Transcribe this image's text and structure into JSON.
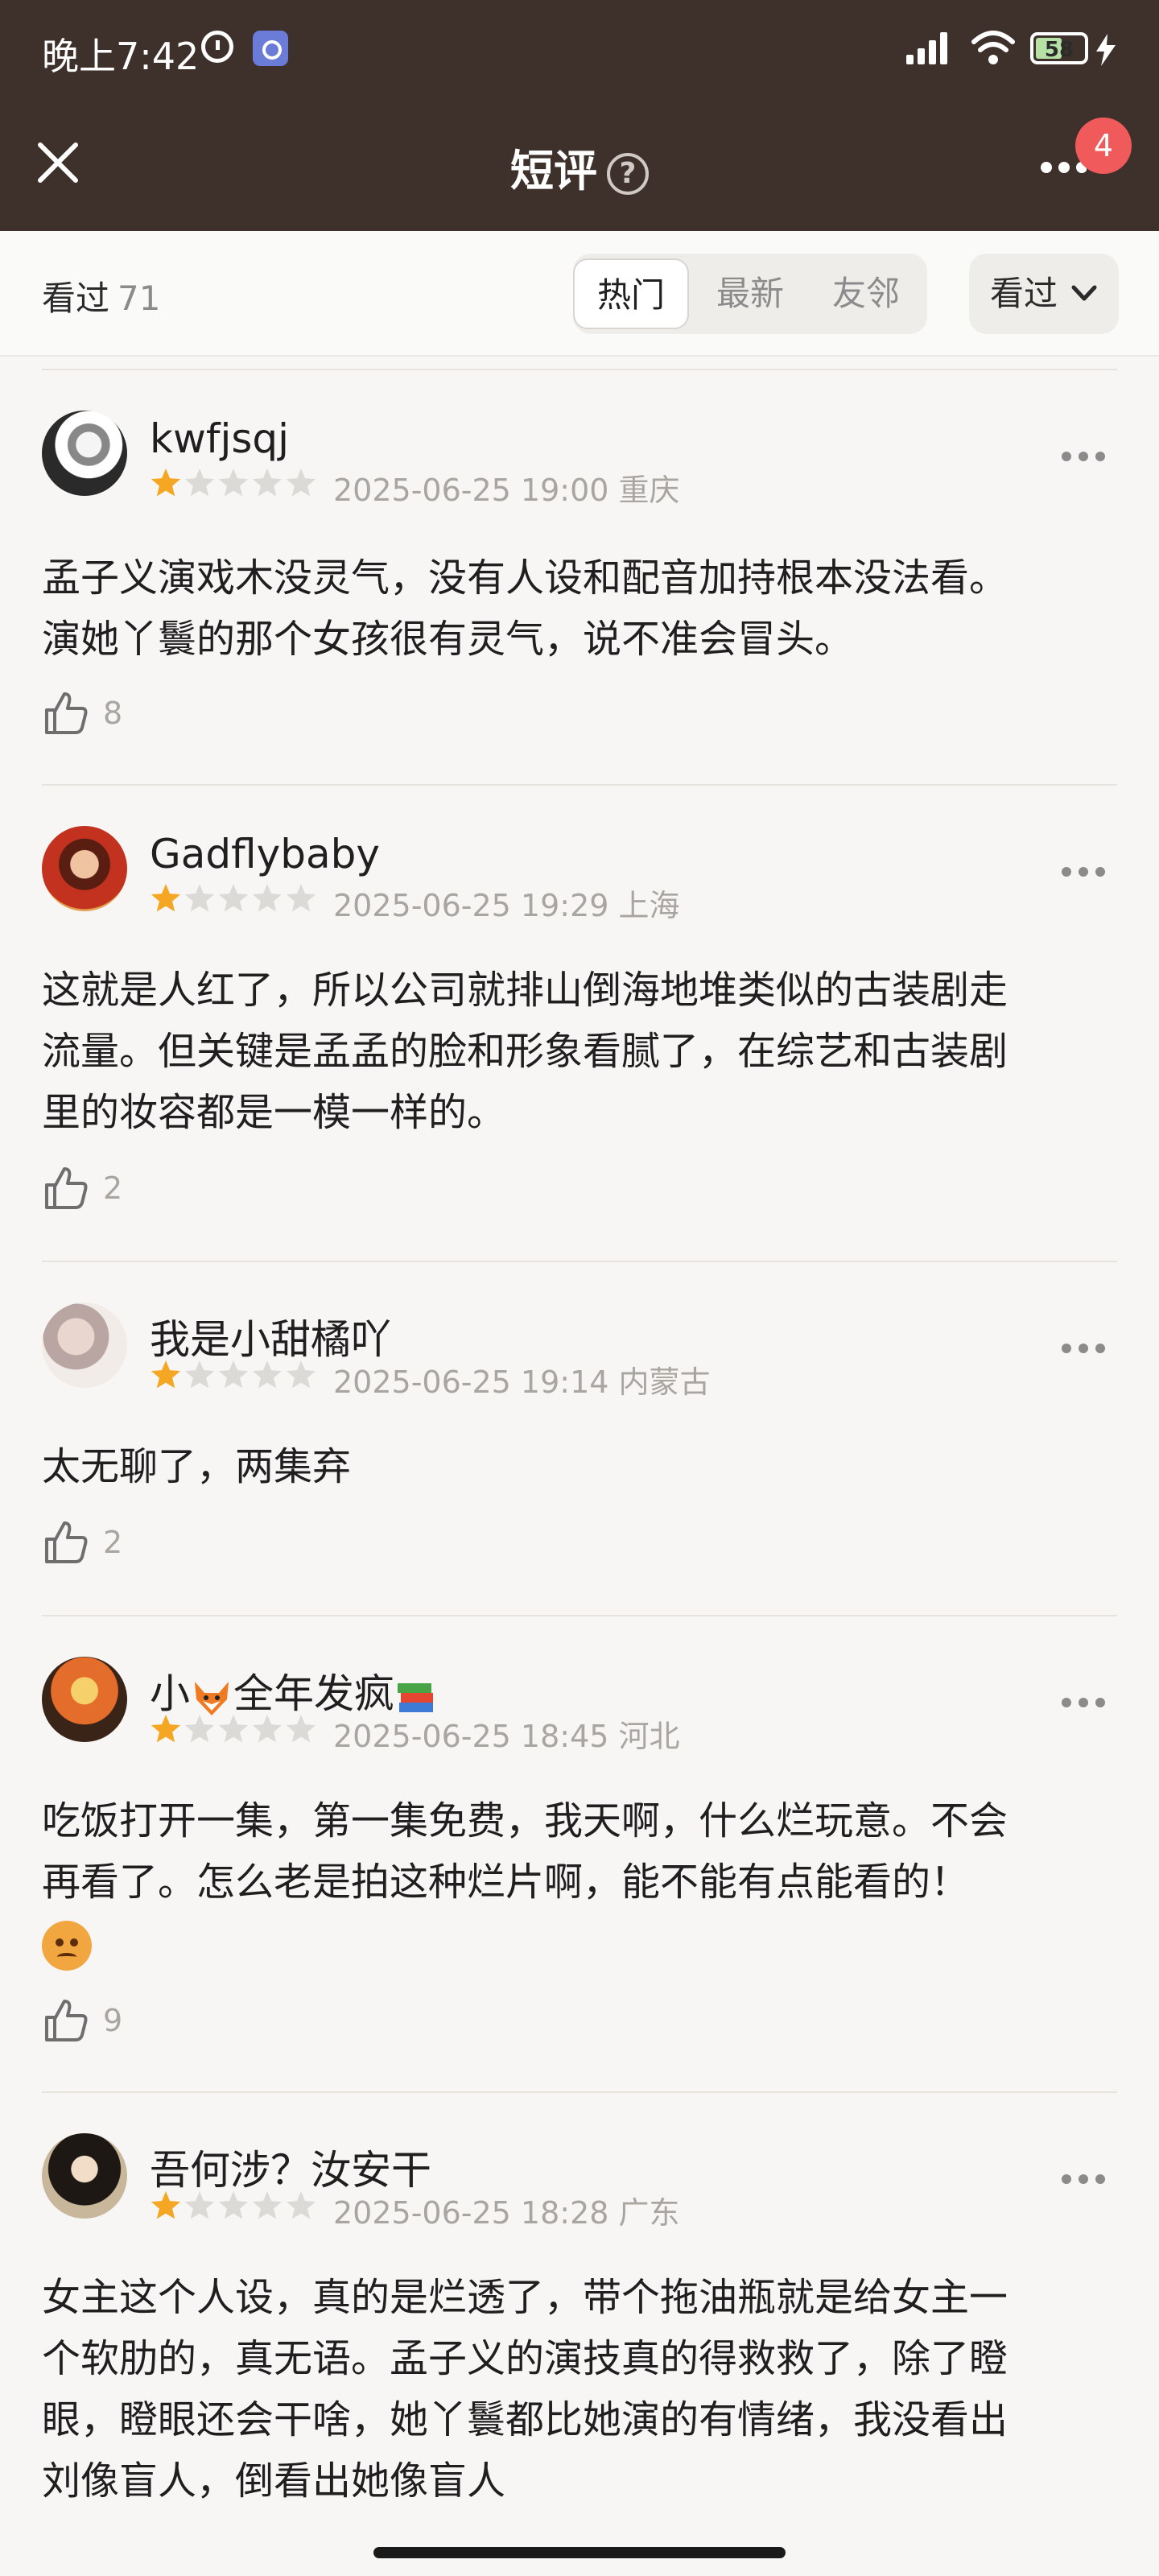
{
  "status_bar": {
    "time": "晚上7:42",
    "battery": "58",
    "battery_level": 0.58
  },
  "header": {
    "title": "短评",
    "help": "?",
    "notification_count": "4"
  },
  "filter_bar": {
    "label": "看过",
    "count": "71",
    "tabs": [
      "热门",
      "最新",
      "友邻"
    ],
    "active_tab": "热门",
    "dropdown_label": "看过"
  },
  "reviews": [
    {
      "username": "kwfjsqj",
      "rating": 1,
      "rating_max": 5,
      "date": "2025-06-25 19:00",
      "location": "重庆",
      "lines": [
        "孟子义演戏木没灵气，没有人设和配音加持根本没法看。",
        "演她丫鬟的那个女孩很有灵气，说不准会冒头。"
      ],
      "likes": "8"
    },
    {
      "username": "Gadflybaby",
      "rating": 1,
      "rating_max": 5,
      "date": "2025-06-25 19:29",
      "location": "上海",
      "lines": [
        "这就是人红了，所以公司就排山倒海地堆类似的古装剧走",
        "流量。但关键是孟孟的脸和形象看腻了，在综艺和古装剧",
        "里的妆容都是一模一样的。"
      ],
      "likes": "2"
    },
    {
      "username": "我是小甜橘吖",
      "rating": 1,
      "rating_max": 5,
      "date": "2025-06-25 19:14",
      "location": "内蒙古",
      "lines": [
        "太无聊了，两集弃"
      ],
      "likes": "2"
    },
    {
      "username_pre": "小",
      "username_mid": "全年发疯",
      "rating": 1,
      "rating_max": 5,
      "date": "2025-06-25 18:45",
      "location": "河北",
      "lines": [
        "吃饭打开一集，第一集免费，我天啊，什么烂玩意。不会",
        "再看了。怎么老是拍这种烂片啊，能不能有点能看的！"
      ],
      "likes": "9"
    },
    {
      "username": "吾何涉？汝安干",
      "rating": 1,
      "rating_max": 5,
      "date": "2025-06-25 18:28",
      "location": "广东",
      "lines": [
        "女主这个人设，真的是烂透了，带个拖油瓶就是给女主一",
        "个软肋的，真无语。孟子义的演技真的得救救了，除了瞪",
        "眼，瞪眼还会干啥，她丫鬟都比她演的有情绪，我没看出",
        "刘像盲人，倒看出她像盲人"
      ]
    }
  ],
  "colors": {
    "header_bg": "#3e312b",
    "star_on": "#f5a623",
    "star_off": "#dcdad6",
    "badge": "#f15a5a"
  }
}
